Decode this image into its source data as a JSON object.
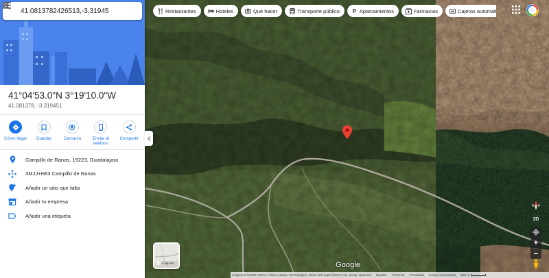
{
  "search": {
    "value": "41.0813782426513,-3.319451",
    "menu_icon": "menu-icon",
    "search_icon": "search-icon",
    "close_icon": "close-icon"
  },
  "place": {
    "title": "41°04'53.0\"N 3°19'10.0\"W",
    "decimal": "41.081378, -3.319451"
  },
  "actions": [
    {
      "label": "Cómo llegar",
      "icon": "directions-icon"
    },
    {
      "label": "Guardar",
      "icon": "bookmark-icon"
    },
    {
      "label": "Cercanía",
      "icon": "nearby-icon"
    },
    {
      "label": "Enviar al teléfono",
      "icon": "phone-icon"
    },
    {
      "label": "Compartir",
      "icon": "share-icon"
    }
  ],
  "info": [
    {
      "text": "Campillo de Ranas, 19223, Guadalajara",
      "icon": "location-pin-icon"
    },
    {
      "text": "3MJJ+H63 Campillo de Ranas",
      "icon": "plus-code-icon"
    },
    {
      "text": "Añadir un sitio que falta",
      "icon": "add-place-icon"
    },
    {
      "text": "Añadir tu empresa",
      "icon": "business-icon"
    },
    {
      "text": "Añadir una etiqueta",
      "icon": "label-icon"
    }
  ],
  "chips": [
    {
      "label": "Restaurantes",
      "icon": "restaurant-icon"
    },
    {
      "label": "Hoteles",
      "icon": "hotel-icon"
    },
    {
      "label": "Qué hacer",
      "icon": "camera-icon"
    },
    {
      "label": "Transporte público",
      "icon": "transit-icon"
    },
    {
      "label": "Aparcamientos",
      "icon": "parking-icon"
    },
    {
      "label": "Farmacias",
      "icon": "pharmacy-icon"
    },
    {
      "label": "Cajeros automáticos",
      "icon": "atm-icon"
    }
  ],
  "controls": {
    "tilt_label": "3D",
    "zoom_in": "+",
    "zoom_out": "−"
  },
  "layers_label": "Capas",
  "logo": "Google",
  "attribution": {
    "imagery": "Imágenes ©2023 CNES / Airbus, Maxar Technologies, Datos del mapa ©2023 Inst. Geogr. Nacional",
    "country": "España",
    "terms": "Términos",
    "privacy": "Privacidad",
    "feedback": "Enviar comentarios",
    "scale": "100 m"
  },
  "colors": {
    "accent": "#1a73e8",
    "pin": "#ea4335",
    "hero": "#4a83ec"
  }
}
